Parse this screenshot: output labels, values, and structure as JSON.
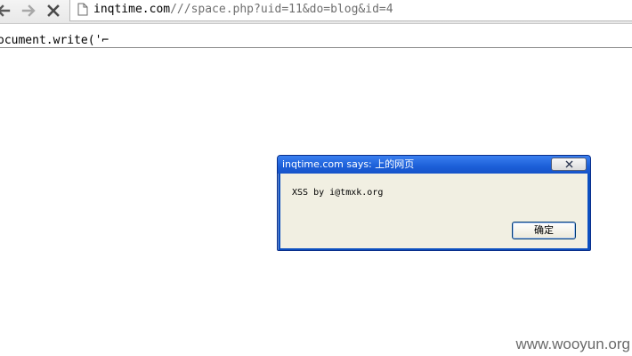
{
  "toolbar": {
    "back_icon": "back-arrow-icon",
    "forward_icon": "forward-arrow-icon",
    "stop_icon": "stop-x-icon",
    "page_icon": "page-document-icon",
    "url_host": "inqtime.com",
    "url_rest": "///space.php?uid=11&do=blog&id=4"
  },
  "page": {
    "source_text": "ocument.write('⌐"
  },
  "dialog": {
    "title": "inqtime.com says: 上的网页",
    "close_icon": "close-x-icon",
    "message": "XSS by i@tmxk.org",
    "ok_label": "确定"
  },
  "watermark": {
    "text": "www.wooyun.org"
  }
}
